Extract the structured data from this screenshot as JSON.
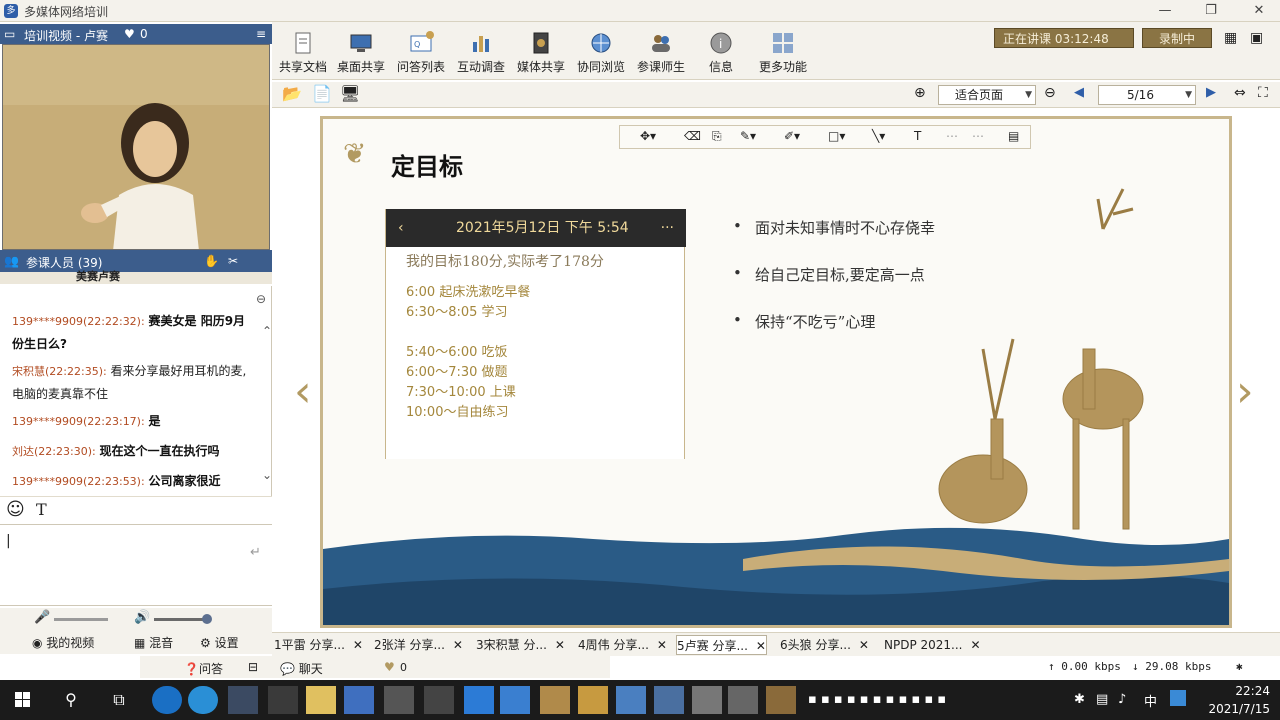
{
  "window": {
    "title": "多媒体网络培训",
    "minimize": "—",
    "restore": "❐",
    "close": "✕"
  },
  "video_panel": {
    "header_label": "培训视频 - 卢赛",
    "likes": "0",
    "participants_label": "参课人员 (39)",
    "participant_row": "美赛卢赛"
  },
  "chat": {
    "messages": [
      {
        "who": "139****9909(22:22:32):",
        "text": "赛美女是 阳历9月份生日么?"
      },
      {
        "who": "宋积慧(22:22:35):",
        "text": "看来分享最好用耳机的麦,电脑的麦真靠不住"
      },
      {
        "who": "139****9909(22:23:17):",
        "text": "是"
      },
      {
        "who": "刘达(22:23:30):",
        "text": "现在这个一直在执行吗"
      },
      {
        "who": "139****9909(22:23:53):",
        "text": "公司离家很近"
      }
    ],
    "tools": {
      "emoji": "☺",
      "font": "T"
    }
  },
  "bottom_left": {
    "my_video": "我的视频",
    "mixer": "混音",
    "settings": "设置",
    "qa": "问答",
    "chat": "聊天",
    "heart_count": "0"
  },
  "toolbar": {
    "items": [
      {
        "label": "共享文档",
        "icon": "document-icon"
      },
      {
        "label": "桌面共享",
        "icon": "desktop-share-icon"
      },
      {
        "label": "问答列表",
        "icon": "qa-list-icon"
      },
      {
        "label": "互动调查",
        "icon": "survey-icon"
      },
      {
        "label": "媒体共享",
        "icon": "media-share-icon"
      },
      {
        "label": "协同浏览",
        "icon": "cobrowse-icon"
      },
      {
        "label": "参课师生",
        "icon": "attendees-icon"
      },
      {
        "label": "信息",
        "icon": "info-icon"
      },
      {
        "label": "更多功能",
        "icon": "more-icon"
      }
    ],
    "status": "正在讲课 03:12:48",
    "record": "录制中"
  },
  "toolbar2": {
    "zoom": "适合页面",
    "page": "5/16"
  },
  "slide": {
    "title": "定目标",
    "phone": {
      "date": "2021年5月12日 下午 5:54",
      "note": "我的目标180分,实际考了178分",
      "schedule": [
        "6:00 起床洗漱吃早餐",
        "6:30～8:05 学习",
        "5:40～6:00 吃饭",
        "6:00～7:30 做题",
        "7:30～10:00 上课",
        "10:00～自由练习"
      ]
    },
    "bullets": [
      "面对未知事情时不心存侥幸",
      "给自己定目标,要定高一点",
      "保持“不吃亏”心理"
    ]
  },
  "tabs": [
    {
      "label": "1平雷 分享..."
    },
    {
      "label": "2张洋 分享..."
    },
    {
      "label": "3宋积慧 分..."
    },
    {
      "label": "4周伟 分享..."
    },
    {
      "label": "5卢赛 分享..."
    },
    {
      "label": "6头狼 分享..."
    },
    {
      "label": "NPDP 2021..."
    }
  ],
  "network": {
    "up": "↑ 0.00 kbps",
    "down": "↓ 29.08 kbps"
  },
  "taskbar": {
    "time": "22:24",
    "date": "2021/7/15",
    "ime": "中"
  },
  "colors": {
    "accent_blue": "#3c5d8c",
    "gold": "#c8b68c",
    "status_brown": "#8a7444"
  }
}
